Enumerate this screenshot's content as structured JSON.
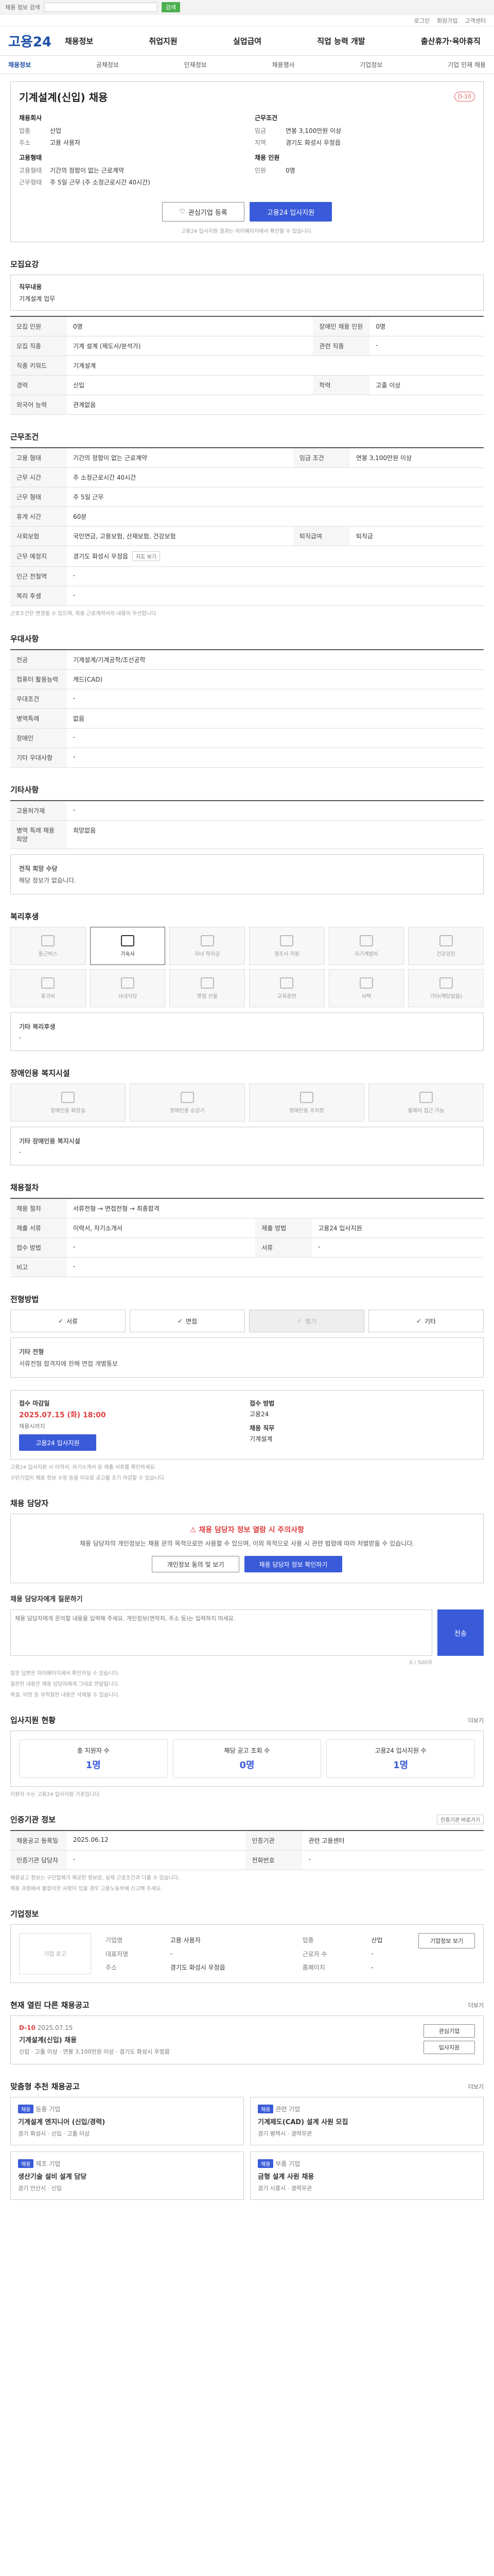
{
  "topbar": {
    "notice": "채용 정보 검색",
    "button": "검색"
  },
  "util": {
    "links": [
      "로그인",
      "회원가입",
      "고객센터"
    ]
  },
  "gnb": {
    "logo": "고용24",
    "menu": [
      "채용정보",
      "취업지원",
      "실업급여",
      "직업 능력 개발",
      "출산휴가·육아휴직"
    ]
  },
  "subnav": {
    "items": [
      "채용정보",
      "공채정보",
      "인재정보",
      "채용행사",
      "기업정보",
      "기업 인재 채용"
    ]
  },
  "job": {
    "title": "기계설계(신입) 채용",
    "dday": "D-10",
    "left_section": "채용회사",
    "left_rows": [
      {
        "k": "업종",
        "v": "산업"
      },
      {
        "k": "주소",
        "v": "고용 사용자"
      }
    ],
    "left_section2": "고용형태",
    "left_rows2": [
      {
        "k": "고용형태",
        "v": "기간의 정함이 없는 근로계약"
      },
      {
        "k": "근무형태",
        "v": "주 5일 근무 (주 소정근로시간 40시간)"
      }
    ],
    "right_section": "근무조건",
    "right_rows": [
      {
        "k": "임금",
        "v": "연봉 3,100만원 이상"
      },
      {
        "k": "지역",
        "v": "경기도 화성시 우정읍"
      }
    ],
    "right_section2": "채용 인원",
    "right_rows2": [
      {
        "k": "인원",
        "v": "0명"
      }
    ],
    "btn_save": "관심기업 등록",
    "btn_apply": "고용24 입사지원",
    "note": "고용24 입사지원 결과는 마이페이지에서 확인할 수 있습니다."
  },
  "recruit": {
    "title": "모집요강",
    "duty_label": "직무내용",
    "duty_value": "기계설계 업무",
    "rows": [
      {
        "k": "모집 인원",
        "v": "0명",
        "k2": "장애인 채용 인원",
        "v2": "0명"
      },
      {
        "k": "모집 직종",
        "v": "기계 설계 (제도사/분석가)",
        "k2": "관련 직종",
        "v2": "-"
      },
      {
        "k": "직종 키워드",
        "v": "기계설계",
        "k2": "",
        "v2": ""
      },
      {
        "k": "경력",
        "v": "신입",
        "k2": "학력",
        "v2": "고졸 이상"
      },
      {
        "k": "외국어 능력",
        "v": "관계없음",
        "k2": "",
        "v2": ""
      }
    ]
  },
  "conditions": {
    "title": "근무조건",
    "rows": [
      {
        "k": "고용 형태",
        "v": "기간의 정함이 없는 근로계약",
        "k2": "임금 조건",
        "v2": "연봉 3,100만원 이상"
      },
      {
        "k": "근무 시간",
        "v": "주 소정근로시간 40시간",
        "k2": "",
        "v2": ""
      },
      {
        "k": "근무 형태",
        "v": "주 5일 근무",
        "k2": "",
        "v2": ""
      },
      {
        "k": "휴게 시간",
        "v": "60분",
        "k2": "",
        "v2": ""
      },
      {
        "k": "사회보험",
        "v": "국민연금, 고용보험, 산재보험, 건강보험",
        "k2": "퇴직급여",
        "v2": "퇴직금"
      },
      {
        "k": "근무 예정지",
        "v": "경기도 화성시 우정읍",
        "k2": "",
        "v2": ""
      },
      {
        "k": "인근 전철역",
        "v": "-",
        "k2": "",
        "v2": ""
      },
      {
        "k": "복리 후생",
        "v": "-",
        "k2": "",
        "v2": ""
      }
    ],
    "chip": "지도 보기",
    "note": "근로조건은 변경될 수 있으며, 최종 근로계약서의 내용이 우선합니다."
  },
  "benefits_table": {
    "title": "우대사항",
    "rows": [
      {
        "k": "전공",
        "v": "기계설계/기계공학/조선공학"
      },
      {
        "k": "컴퓨터 활용능력",
        "v": "캐드(CAD)"
      },
      {
        "k": "우대조건",
        "v": "-"
      },
      {
        "k": "병역특례",
        "v": "없음"
      },
      {
        "k": "장애인",
        "v": "-"
      },
      {
        "k": "기타 우대사항",
        "v": "-"
      }
    ]
  },
  "other": {
    "title": "기타사항",
    "rows": [
      {
        "k": "고용허가제",
        "v": "-"
      },
      {
        "k": "병역 특례 채용 희망",
        "v": "희망없음"
      }
    ],
    "sub_title": "전직 희망 수당",
    "sub_text": "해당 정보가 없습니다."
  },
  "welfare": {
    "title": "복리후생",
    "icons": [
      {
        "label": "통근버스",
        "on": false
      },
      {
        "label": "기숙사",
        "on": true
      },
      {
        "label": "자녀 학자금",
        "on": false
      },
      {
        "label": "경조사 지원",
        "on": false
      },
      {
        "label": "자기계발비",
        "on": false
      },
      {
        "label": "건강검진",
        "on": false
      },
      {
        "label": "휴가비",
        "on": false
      },
      {
        "label": "사내식당",
        "on": false
      },
      {
        "label": "명절 선물",
        "on": false
      },
      {
        "label": "교육훈련",
        "on": false
      },
      {
        "label": "사택",
        "on": false
      },
      {
        "label": "기타(해당없음)",
        "on": false
      }
    ],
    "extra_title": "기타 복리후생",
    "extra_text": "-"
  },
  "facility": {
    "title": "장애인용 복지시설",
    "icons": [
      "장애인용 화장실",
      "장애인용 승강기",
      "장애인용 주차장",
      "휠체어 접근 가능"
    ],
    "extra_title": "기타 장애인용 복지시설",
    "extra_text": "-"
  },
  "process": {
    "title": "채용절차",
    "rows": [
      {
        "k": "채용 절차",
        "v": "서류전형 → 면접전형 → 최종합격"
      },
      {
        "k": "제출 서류",
        "v": "이력서, 자기소개서",
        "k2": "제출 방법",
        "v2": "고용24 입사지원"
      },
      {
        "k": "접수 방법",
        "v": "-",
        "k2": "서류",
        "v2": "-"
      },
      {
        "k": "비고",
        "v": "-",
        "k2": "",
        "v2": ""
      }
    ]
  },
  "method": {
    "title": "전형방법",
    "items": [
      {
        "label": "서류",
        "on": true
      },
      {
        "label": "면접",
        "on": true
      },
      {
        "label": "필기",
        "on": false
      },
      {
        "label": "기타",
        "on": true
      }
    ],
    "extra_title": "기타 전형",
    "extra_text": "서류전형 합격자에 한해 면접 개별통보"
  },
  "apply": {
    "period_label": "접수 마감일",
    "period_value": "2025.07.15 (화) 18:00",
    "period_sub": "채용시까지",
    "apply_btn": "고용24 입사지원",
    "result_label": "접수 방법",
    "result_value": "고용24",
    "result_label2": "채용 직무",
    "result_value2": "기계설계",
    "notes": [
      "고용24 입사지원 시 이력서, 자기소개서 등 제출 서류를 확인하세요.",
      "구인기업이 채용 정보 수정 등을 이유로 공고를 조기 마감할 수 있습니다."
    ]
  },
  "manager": {
    "title": "채용 담당자",
    "warn_title": "채용 담당자 정보 열람 시 주의사항",
    "warn_text": "채용 담당자의 개인정보는 채용 문의 목적으로만 사용할 수 있으며, 이외 목적으로 사용 시 관련 법령에 따라 처벌받을 수 있습니다.",
    "btn_view": "개인정보 동의 및 보기",
    "btn_apply": "채용 담당자 정보 확인하기"
  },
  "inquiry": {
    "title": "채용 담당자에게 질문하기",
    "placeholder": "채용 담당자에게 문의할 내용을 입력해 주세요. 개인정보(연락처, 주소 등)는 입력하지 마세요.",
    "count": "0 / 500자",
    "send": "전송",
    "notes": [
      "질문 답변은 마이페이지에서 확인하실 수 있습니다.",
      "질문한 내용은 채용 담당자에게 그대로 전달됩니다.",
      "욕설, 비방 등 부적절한 내용은 삭제될 수 있습니다."
    ]
  },
  "applicants": {
    "title": "입사지원 현황",
    "more": "더보기",
    "items": [
      {
        "label": "총 지원자 수",
        "value": "1명"
      },
      {
        "label": "해당 공고 조회 수",
        "value": "0명"
      },
      {
        "label": "고용24 입사지원 수",
        "value": "1명"
      }
    ],
    "note": "지원자 수는 고용24 입사지원 기준입니다."
  },
  "jobinfo": {
    "title": "인증기관 정보",
    "chip": "인증기관 바로가기",
    "rows": [
      {
        "k": "채용공고 등록일",
        "v": "2025.06.12",
        "k2": "인증기관",
        "v2": "관련 고용센터"
      },
      {
        "k": "인증기관 담당자",
        "v": "-",
        "k2": "전화번호",
        "v2": "-"
      }
    ],
    "notes": [
      "채용공고 정보는 구인업체가 제공한 정보로, 실제 근로조건과 다를 수 있습니다.",
      "채용 과정에서 불합리한 사항이 있을 경우 고용노동부에 신고해 주세요."
    ]
  },
  "company": {
    "title": "기업정보",
    "logo": "기업 로고",
    "rows": [
      {
        "k": "기업명",
        "v": "고용 사용자",
        "k2": "업종",
        "v2": "산업"
      },
      {
        "k": "대표자명",
        "v": "-",
        "k2": "근로자 수",
        "v2": "-"
      },
      {
        "k": "주소",
        "v": "경기도 화성시 우정읍",
        "k2": "홈페이지",
        "v2": "-"
      }
    ],
    "btn": "기업정보 보기"
  },
  "recommend": {
    "title": "현재 열린 다른 채용공고",
    "more": "더보기",
    "dday": "D-10",
    "date": "2025.07.15",
    "job_title": "기계설계(신입) 채용",
    "meta": [
      "신입",
      "고졸 이상",
      "연봉 3,100만원 이상",
      "경기도 화성시 우정읍"
    ],
    "btns": [
      "관심기업",
      "입사지원"
    ]
  },
  "similar": {
    "title": "맞춤형 추천 채용공고",
    "more": "더보기",
    "cards": [
      {
        "tag": "채용",
        "company": "동종 기업",
        "title": "기계설계 엔지니어 (신입/경력)",
        "meta": "경기 화성시 · 신입 · 고졸 이상"
      },
      {
        "tag": "채용",
        "company": "관련 기업",
        "title": "기계제도(CAD) 설계 사원 모집",
        "meta": "경기 평택시 · 경력무관"
      },
      {
        "tag": "채용",
        "company": "제조 기업",
        "title": "생산기술 설비 설계 담당",
        "meta": "경기 안산시 · 신입"
      },
      {
        "tag": "채용",
        "company": "부품 기업",
        "title": "금형 설계 사원 채용",
        "meta": "경기 시흥시 · 경력무관"
      }
    ]
  }
}
